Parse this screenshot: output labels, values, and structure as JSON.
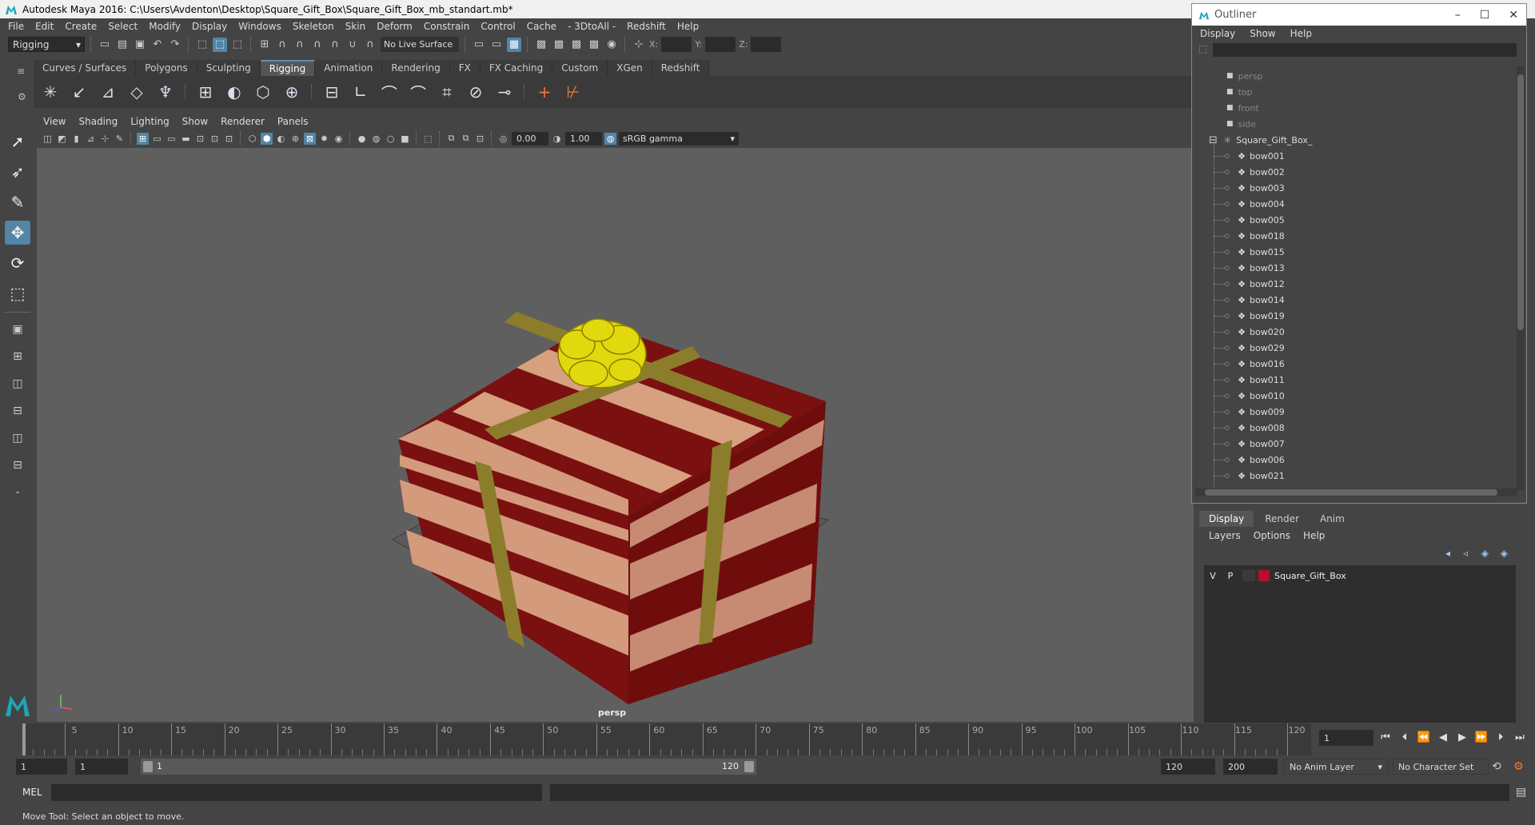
{
  "window": {
    "title": "Autodesk Maya 2016: C:\\Users\\Avdenton\\Desktop\\Square_Gift_Box\\Square_Gift_Box_mb_standart.mb*"
  },
  "menus": [
    "File",
    "Edit",
    "Create",
    "Select",
    "Modify",
    "Display",
    "Windows",
    "Skeleton",
    "Skin",
    "Deform",
    "Constrain",
    "Control",
    "Cache",
    "- 3DtoAll -",
    "Redshift",
    "Help"
  ],
  "statusline": {
    "mode": "Rigging",
    "live_surface": "No Live Surface",
    "x_label": "X:",
    "y_label": "Y:",
    "z_label": "Z:"
  },
  "shelf": {
    "tabs": [
      "Curves / Surfaces",
      "Polygons",
      "Sculpting",
      "Rigging",
      "Animation",
      "Rendering",
      "FX",
      "FX Caching",
      "Custom",
      "XGen",
      "Redshift"
    ],
    "active_tab": "Rigging"
  },
  "viewport": {
    "menu": [
      "View",
      "Shading",
      "Lighting",
      "Show",
      "Renderer",
      "Panels"
    ],
    "exposure": "0.00",
    "gamma_value": "1.00",
    "color_space": "sRGB gamma",
    "camera_label": "persp"
  },
  "colors": {
    "accent": "#5285a6",
    "box_red": "#7a1010",
    "box_tan": "#d79c7e",
    "ribbon": "#8c7d2c",
    "bow": "#e2d80e",
    "layer_color": "#b4102c"
  },
  "timeline": {
    "ticks": [
      "5",
      "10",
      "15",
      "20",
      "25",
      "30",
      "35",
      "40",
      "45",
      "50",
      "55",
      "60",
      "65",
      "70",
      "75",
      "80",
      "85",
      "90",
      "95",
      "100",
      "105",
      "110",
      "115",
      "120"
    ],
    "start_tick": "1",
    "current_frame": "1"
  },
  "range": {
    "start": "1",
    "playback_start": "1",
    "slider_start": "1",
    "slider_end": "120",
    "playback_end": "120",
    "end": "200",
    "anim_layer": "No Anim Layer",
    "character_set": "No Character Set"
  },
  "command": {
    "label": "MEL"
  },
  "help_line": "Move Tool: Select an object to move.",
  "outliner": {
    "title": "Outliner",
    "menu": [
      "Display",
      "Show",
      "Help"
    ],
    "cameras": [
      "persp",
      "top",
      "front",
      "side"
    ],
    "group": "Square_Gift_Box_",
    "children": [
      "bow001",
      "bow002",
      "bow003",
      "bow004",
      "bow005",
      "bow018",
      "bow015",
      "bow013",
      "bow012",
      "bow014",
      "bow019",
      "bow020",
      "bow029",
      "bow016",
      "bow011",
      "bow010",
      "bow009",
      "bow008",
      "bow007",
      "bow006",
      "bow021"
    ]
  },
  "layer_editor": {
    "tabs": [
      "Display",
      "Render",
      "Anim"
    ],
    "active_tab": "Display",
    "menu": [
      "Layers",
      "Options",
      "Help"
    ],
    "layers": [
      {
        "v": "V",
        "p": "P",
        "name": "Square_Gift_Box"
      }
    ]
  }
}
